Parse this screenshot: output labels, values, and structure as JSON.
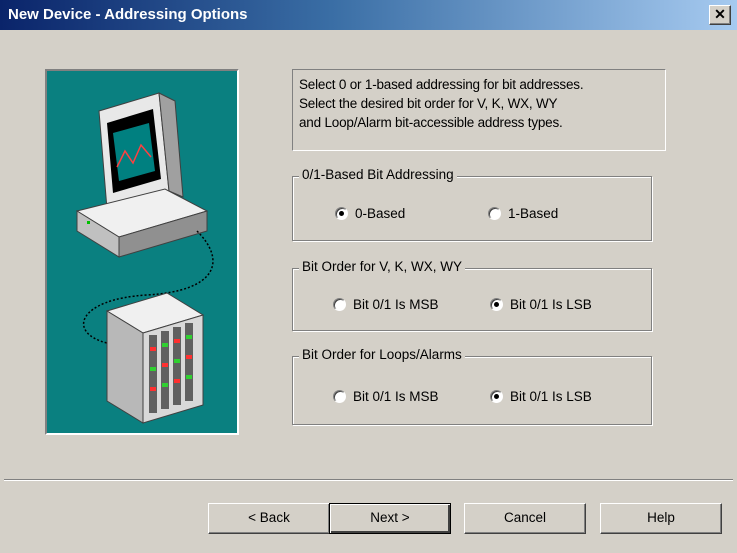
{
  "window": {
    "title": "New Device - Addressing Options",
    "close_glyph": "✕"
  },
  "info_text": [
    "Select 0 or 1-based addressing for bit addresses.",
    "Select the desired bit order for V, K, WX, WY",
    "and Loop/Alarm bit-accessible address types."
  ],
  "groups": {
    "bit_addressing": {
      "legend": "0/1-Based Bit Addressing",
      "options": [
        "0-Based",
        "1-Based"
      ],
      "selected": "0-Based"
    },
    "bit_order_vk": {
      "legend": "Bit Order for V, K, WX, WY",
      "options": [
        "Bit 0/1 Is MSB",
        "Bit 0/1 Is LSB"
      ],
      "selected": "Bit 0/1 Is LSB"
    },
    "bit_order_loops": {
      "legend": "Bit Order for Loops/Alarms",
      "options": [
        "Bit 0/1 Is MSB",
        "Bit 0/1 Is LSB"
      ],
      "selected": "Bit 0/1 Is LSB"
    }
  },
  "buttons": {
    "back": "< Back",
    "next": "Next >",
    "cancel": "Cancel",
    "help": "Help"
  },
  "colors": {
    "dialog_bg": "#d4d0c8",
    "illustration_bg": "#0a8080",
    "title_active": "#0a246a"
  },
  "icons": [
    "close-icon",
    "computer-icon",
    "plc-device-icon"
  ]
}
